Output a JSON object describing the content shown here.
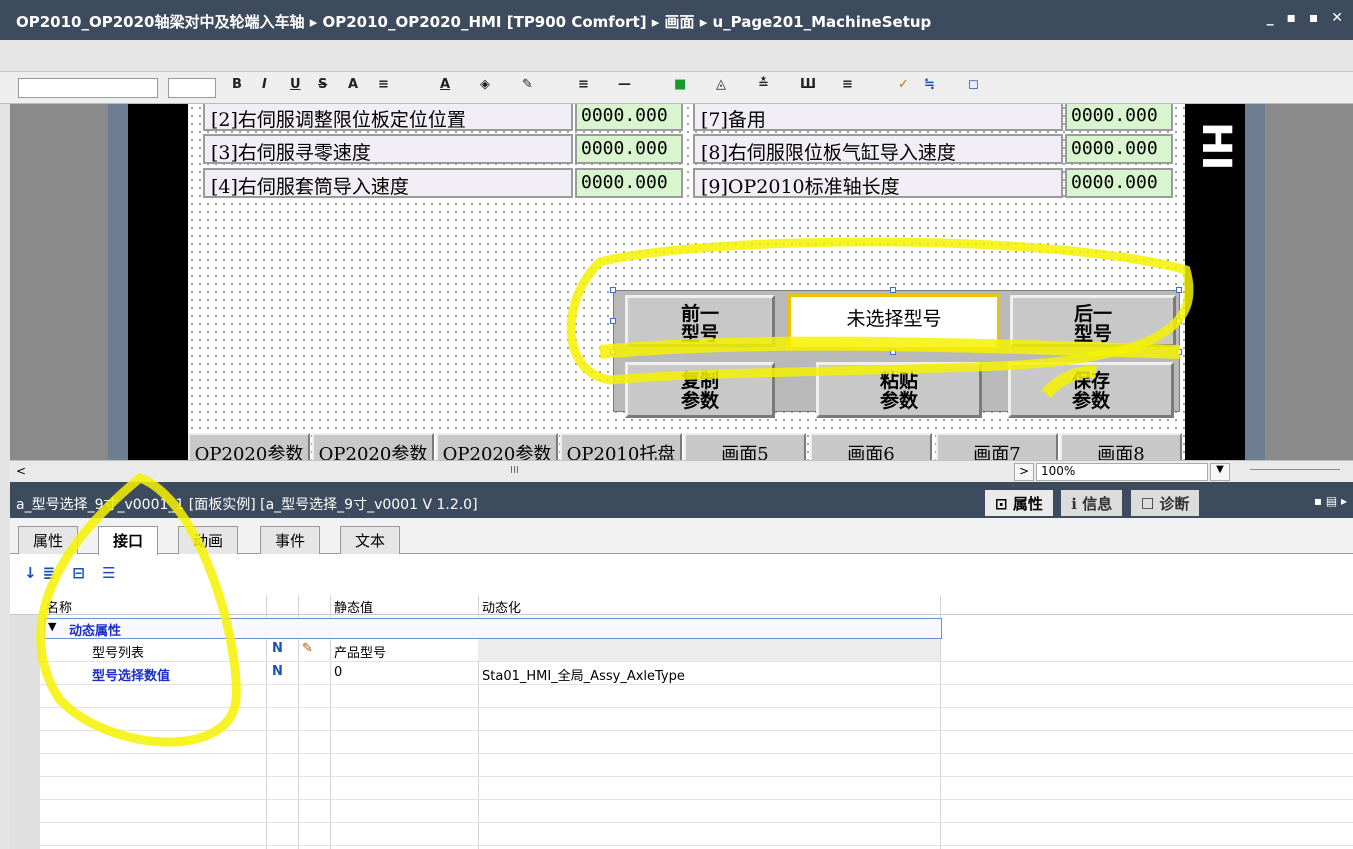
{
  "window": {
    "path": "OP2010_OP2020轴梁对中及轮端入车轴 ▸ OP2010_OP2020_HMI [TP900 Comfort] ▸ 画面 ▸ u_Page201_MachineSetup",
    "controls": "_ ▪ ▪ ✕"
  },
  "toolbar": {
    "items": [
      "B",
      "I",
      "U",
      "S",
      "A",
      "≡",
      "A",
      "◈",
      "✎",
      "≡",
      "—",
      "■",
      "◬",
      "≛",
      "Ш",
      "≡",
      "✓",
      "≒",
      "◻"
    ]
  },
  "hmi": {
    "rows_left": [
      {
        "label": "[2]右伺服调整限位板定位位置",
        "value": "0000.000"
      },
      {
        "label": "[3]右伺服寻零速度",
        "value": "0000.000"
      },
      {
        "label": "[4]右伺服套筒导入速度",
        "value": "0000.000"
      }
    ],
    "rows_right": [
      {
        "label": "[7]备用",
        "value": "0000.000"
      },
      {
        "label": "[8]右伺服限位板气缸导入速度",
        "value": "0000.000"
      },
      {
        "label": "[9]OP2010标准轴长度",
        "value": "0000.000"
      }
    ],
    "prev_model": {
      "line1": "前一",
      "line2": "型号"
    },
    "model_display": "未选择型号",
    "next_model": {
      "line1": "后一",
      "line2": "型号"
    },
    "copy_params": {
      "line1": "复制",
      "line2": "参数"
    },
    "paste_params": {
      "line1": "粘贴",
      "line2": "参数"
    },
    "save_params": {
      "line1": "保存",
      "line2": "参数"
    },
    "bottom_tabs": [
      "OP2020参数",
      "OP2020参数",
      "OP2020参数",
      "OP2010托盘",
      "画面5",
      "画面6",
      "画面7",
      "画面8"
    ],
    "right_glyph": "HI"
  },
  "scroll": {
    "left_arrow": "<",
    "thumb": "III",
    "zoom_arrow": ">",
    "zoom": "100%",
    "zoom_dropdown": "▼"
  },
  "inspector": {
    "title": "a_型号选择_9寸_v0001_1 [面板实例] [a_型号选择_9寸_v0001 V 1.2.0]",
    "right_tabs": [
      {
        "label": "属性",
        "icon": "⊡"
      },
      {
        "label": "信息",
        "icon": "ℹ"
      },
      {
        "label": "诊断",
        "icon": "☐"
      }
    ],
    "header_icons": "▪ ▤ ▸",
    "tabs": [
      "属性",
      "接口",
      "动画",
      "事件",
      "文本"
    ],
    "active_tab": "接口",
    "tool_icons": "↓≣ ⊟ ☰",
    "columns": {
      "name": "名称",
      "static": "静态值",
      "dynamic": "动态化"
    },
    "group": {
      "label": "动态属性",
      "toggle": "▼"
    },
    "properties": [
      {
        "name": "型号列表",
        "icon1": "N",
        "icon2": "✎",
        "static": "产品型号",
        "dynamic": ""
      },
      {
        "name": "型号选择数值",
        "icon1": "N",
        "icon2": "",
        "static": "0",
        "dynamic": "Sta01_HMI_全局_Assy_AxleType"
      }
    ]
  },
  "colors": {
    "titlebar": "#3d4b5e",
    "highlighter": "#f5f200",
    "value_field": "#d8f5cf",
    "model_border": "#f0c300"
  }
}
